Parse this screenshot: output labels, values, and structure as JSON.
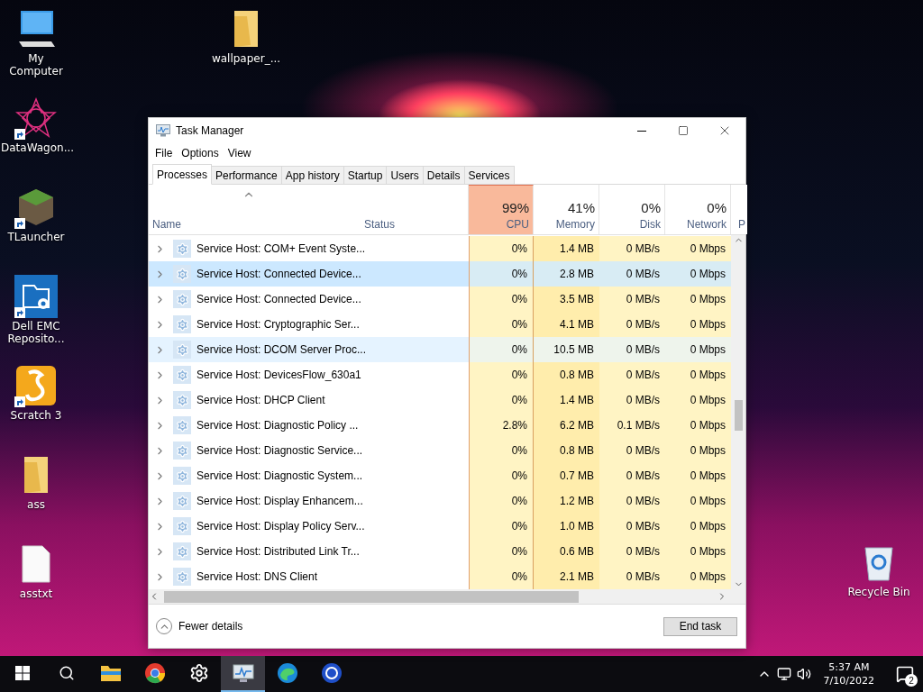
{
  "desktop": {
    "left_icons": [
      {
        "label": "My Computer",
        "kind": "computer",
        "shortcut": false
      },
      {
        "label": "DataWagon...",
        "kind": "star",
        "shortcut": true
      },
      {
        "label": "TLauncher",
        "kind": "block",
        "shortcut": true
      },
      {
        "label": "Dell EMC Reposito...",
        "kind": "gearfolder",
        "shortcut": true
      },
      {
        "label": "Scratch 3",
        "kind": "scratch",
        "shortcut": true
      },
      {
        "label": "ass",
        "kind": "folder",
        "shortcut": false
      },
      {
        "label": "asstxt",
        "kind": "file",
        "shortcut": false
      }
    ],
    "top_icons": [
      {
        "label": "wallpaper_...",
        "kind": "folder",
        "shortcut": false
      }
    ],
    "right_icons": [
      {
        "label": "Recycle Bin",
        "kind": "recycle",
        "shortcut": false
      }
    ]
  },
  "window": {
    "title": "Task Manager",
    "menu": [
      "File",
      "Options",
      "View"
    ],
    "tabs": [
      {
        "label": "Processes",
        "selected": true
      },
      {
        "label": "Performance",
        "selected": false
      },
      {
        "label": "App history",
        "selected": false
      },
      {
        "label": "Startup",
        "selected": false
      },
      {
        "label": "Users",
        "selected": false
      },
      {
        "label": "Details",
        "selected": false
      },
      {
        "label": "Services",
        "selected": false
      }
    ],
    "columns": [
      {
        "kind": "name",
        "label": "Name",
        "highlighted": false
      },
      {
        "kind": "text",
        "label": "Status",
        "highlighted": false
      },
      {
        "kind": "num",
        "label": "CPU",
        "value": "99%",
        "highlighted": true
      },
      {
        "kind": "num",
        "label": "Memory",
        "value": "41%",
        "highlighted": false
      },
      {
        "kind": "num",
        "label": "Disk",
        "value": "0%",
        "highlighted": false
      },
      {
        "kind": "num",
        "label": "Network",
        "value": "0%",
        "highlighted": false
      },
      {
        "kind": "cut",
        "label": "P",
        "highlighted": false
      }
    ],
    "rows": [
      {
        "name": "Service Host: COM+ Event Syste...",
        "cpu": "0%",
        "memory": "1.4 MB",
        "disk": "0 MB/s",
        "network": "0 Mbps",
        "selected": false,
        "hovered": false
      },
      {
        "name": "Service Host: Connected Device...",
        "cpu": "0%",
        "memory": "2.8 MB",
        "disk": "0 MB/s",
        "network": "0 Mbps",
        "selected": true,
        "hovered": false
      },
      {
        "name": "Service Host: Connected Device...",
        "cpu": "0%",
        "memory": "3.5 MB",
        "disk": "0 MB/s",
        "network": "0 Mbps",
        "selected": false,
        "hovered": false
      },
      {
        "name": "Service Host: Cryptographic Ser...",
        "cpu": "0%",
        "memory": "4.1 MB",
        "disk": "0 MB/s",
        "network": "0 Mbps",
        "selected": false,
        "hovered": false
      },
      {
        "name": "Service Host: DCOM Server Proc...",
        "cpu": "0%",
        "memory": "10.5 MB",
        "disk": "0 MB/s",
        "network": "0 Mbps",
        "selected": false,
        "hovered": true
      },
      {
        "name": "Service Host: DevicesFlow_630a1",
        "cpu": "0%",
        "memory": "0.8 MB",
        "disk": "0 MB/s",
        "network": "0 Mbps",
        "selected": false,
        "hovered": false
      },
      {
        "name": "Service Host: DHCP Client",
        "cpu": "0%",
        "memory": "1.4 MB",
        "disk": "0 MB/s",
        "network": "0 Mbps",
        "selected": false,
        "hovered": false
      },
      {
        "name": "Service Host: Diagnostic Policy ...",
        "cpu": "2.8%",
        "memory": "6.2 MB",
        "disk": "0.1 MB/s",
        "network": "0 Mbps",
        "selected": false,
        "hovered": false
      },
      {
        "name": "Service Host: Diagnostic Service...",
        "cpu": "0%",
        "memory": "0.8 MB",
        "disk": "0 MB/s",
        "network": "0 Mbps",
        "selected": false,
        "hovered": false
      },
      {
        "name": "Service Host: Diagnostic System...",
        "cpu": "0%",
        "memory": "0.7 MB",
        "disk": "0 MB/s",
        "network": "0 Mbps",
        "selected": false,
        "hovered": false
      },
      {
        "name": "Service Host: Display Enhancem...",
        "cpu": "0%",
        "memory": "1.2 MB",
        "disk": "0 MB/s",
        "network": "0 Mbps",
        "selected": false,
        "hovered": false
      },
      {
        "name": "Service Host: Display Policy Serv...",
        "cpu": "0%",
        "memory": "1.0 MB",
        "disk": "0 MB/s",
        "network": "0 Mbps",
        "selected": false,
        "hovered": false
      },
      {
        "name": "Service Host: Distributed Link Tr...",
        "cpu": "0%",
        "memory": "0.6 MB",
        "disk": "0 MB/s",
        "network": "0 Mbps",
        "selected": false,
        "hovered": false
      },
      {
        "name": "Service Host: DNS Client",
        "cpu": "0%",
        "memory": "2.1 MB",
        "disk": "0 MB/s",
        "network": "0 Mbps",
        "selected": false,
        "hovered": false
      }
    ],
    "footer": {
      "details_toggle": "Fewer details",
      "end_task": "End task"
    }
  },
  "taskbar": {
    "apps": [
      {
        "kind": "start",
        "active": false
      },
      {
        "kind": "search",
        "active": false
      },
      {
        "kind": "explorer",
        "active": false
      },
      {
        "kind": "chrome",
        "active": false
      },
      {
        "kind": "settings",
        "active": false
      },
      {
        "kind": "taskmgr",
        "active": true
      },
      {
        "kind": "edge",
        "active": false
      },
      {
        "kind": "app",
        "active": false
      }
    ],
    "time": "5:37 AM",
    "date": "7/10/2022",
    "notifications": "2"
  }
}
